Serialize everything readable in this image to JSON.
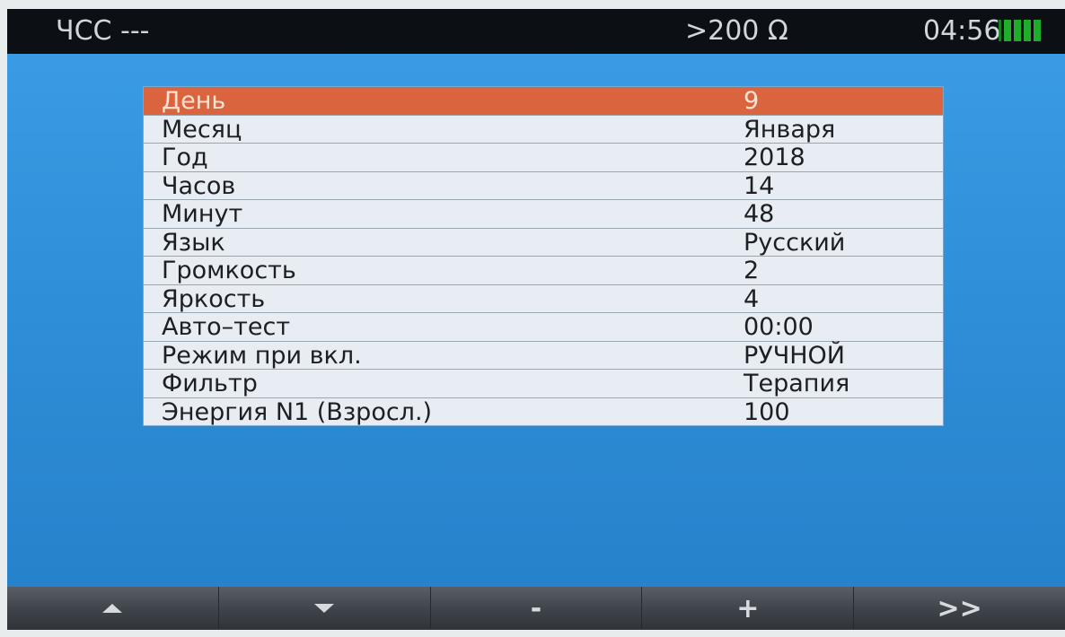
{
  "status": {
    "hr_label": "ЧСС ---",
    "impedance": ">200 Ω",
    "time": "04:56",
    "battery_level": 1.0
  },
  "settings": {
    "selected_index": 0,
    "rows": [
      {
        "label": "День",
        "value": "9"
      },
      {
        "label": "Месяц",
        "value": "Января"
      },
      {
        "label": "Год",
        "value": "2018"
      },
      {
        "label": "Часов",
        "value": "14"
      },
      {
        "label": "Минут",
        "value": "48"
      },
      {
        "label": "Язык",
        "value": "Русский"
      },
      {
        "label": "Громкость",
        "value": "2"
      },
      {
        "label": "Яркость",
        "value": "4"
      },
      {
        "label": "Авто–тест",
        "value": "00:00"
      },
      {
        "label": "Режим при вкл.",
        "value": "РУЧНОЙ"
      },
      {
        "label": "Фильтр",
        "value": "Терапия"
      },
      {
        "label": "Энергия N1 (Взросл.)",
        "value": "100"
      }
    ]
  },
  "softkeys": {
    "up_icon": "triangle-up-icon",
    "down_icon": "triangle-down-icon",
    "minus_label": "-",
    "plus_label": "+",
    "next_label": ">>"
  },
  "colors": {
    "selection": "#d9643e",
    "screen_bg": "#2f8fd8",
    "battery": "#1fae2c"
  }
}
